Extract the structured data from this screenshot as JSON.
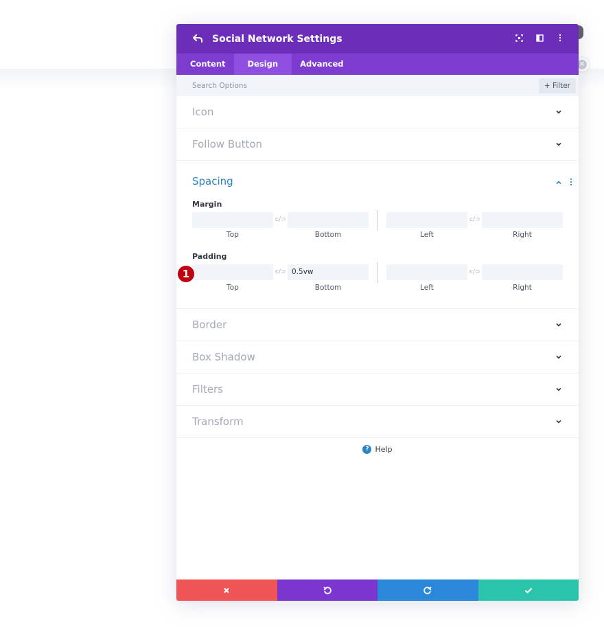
{
  "colors": {
    "header": "#6c2eb9",
    "tabs": "#7e3bd0",
    "active_tab": "#8f4ee0",
    "accent": "#2b87c4",
    "cancel": "#ef5555",
    "undo": "#7b36cf",
    "redo": "#2b87d9",
    "save": "#29c4a9",
    "marker": "#c0000f"
  },
  "header": {
    "back_icon": "undo-arrow-icon",
    "title": "Social Network Settings",
    "icons": [
      "focus-icon",
      "split-view-icon",
      "more-vertical-icon"
    ]
  },
  "tabs": [
    {
      "label": "Content",
      "active": false
    },
    {
      "label": "Design",
      "active": true
    },
    {
      "label": "Advanced",
      "active": false
    }
  ],
  "search": {
    "placeholder": "Search Options",
    "filter_label": "+ Filter"
  },
  "groups_top": [
    {
      "label": "Icon"
    },
    {
      "label": "Follow Button"
    }
  ],
  "spacing": {
    "title": "Spacing",
    "margin": {
      "label": "Margin",
      "fields": [
        {
          "sub": "Top",
          "value": ""
        },
        {
          "sub": "Bottom",
          "value": ""
        },
        {
          "sub": "Left",
          "value": ""
        },
        {
          "sub": "Right",
          "value": ""
        }
      ]
    },
    "padding": {
      "label": "Padding",
      "fields": [
        {
          "sub": "Top",
          "value": ""
        },
        {
          "sub": "Bottom",
          "value": "0.5vw"
        },
        {
          "sub": "Left",
          "value": ""
        },
        {
          "sub": "Right",
          "value": ""
        }
      ]
    }
  },
  "groups_bottom": [
    {
      "label": "Border"
    },
    {
      "label": "Box Shadow"
    },
    {
      "label": "Filters"
    },
    {
      "label": "Transform"
    }
  ],
  "help": {
    "label": "Help"
  },
  "footer": {
    "cancel_icon": "close-icon",
    "undo_icon": "undo-icon",
    "redo_icon": "redo-icon",
    "save_icon": "check-icon"
  },
  "marker": {
    "label": "1"
  }
}
